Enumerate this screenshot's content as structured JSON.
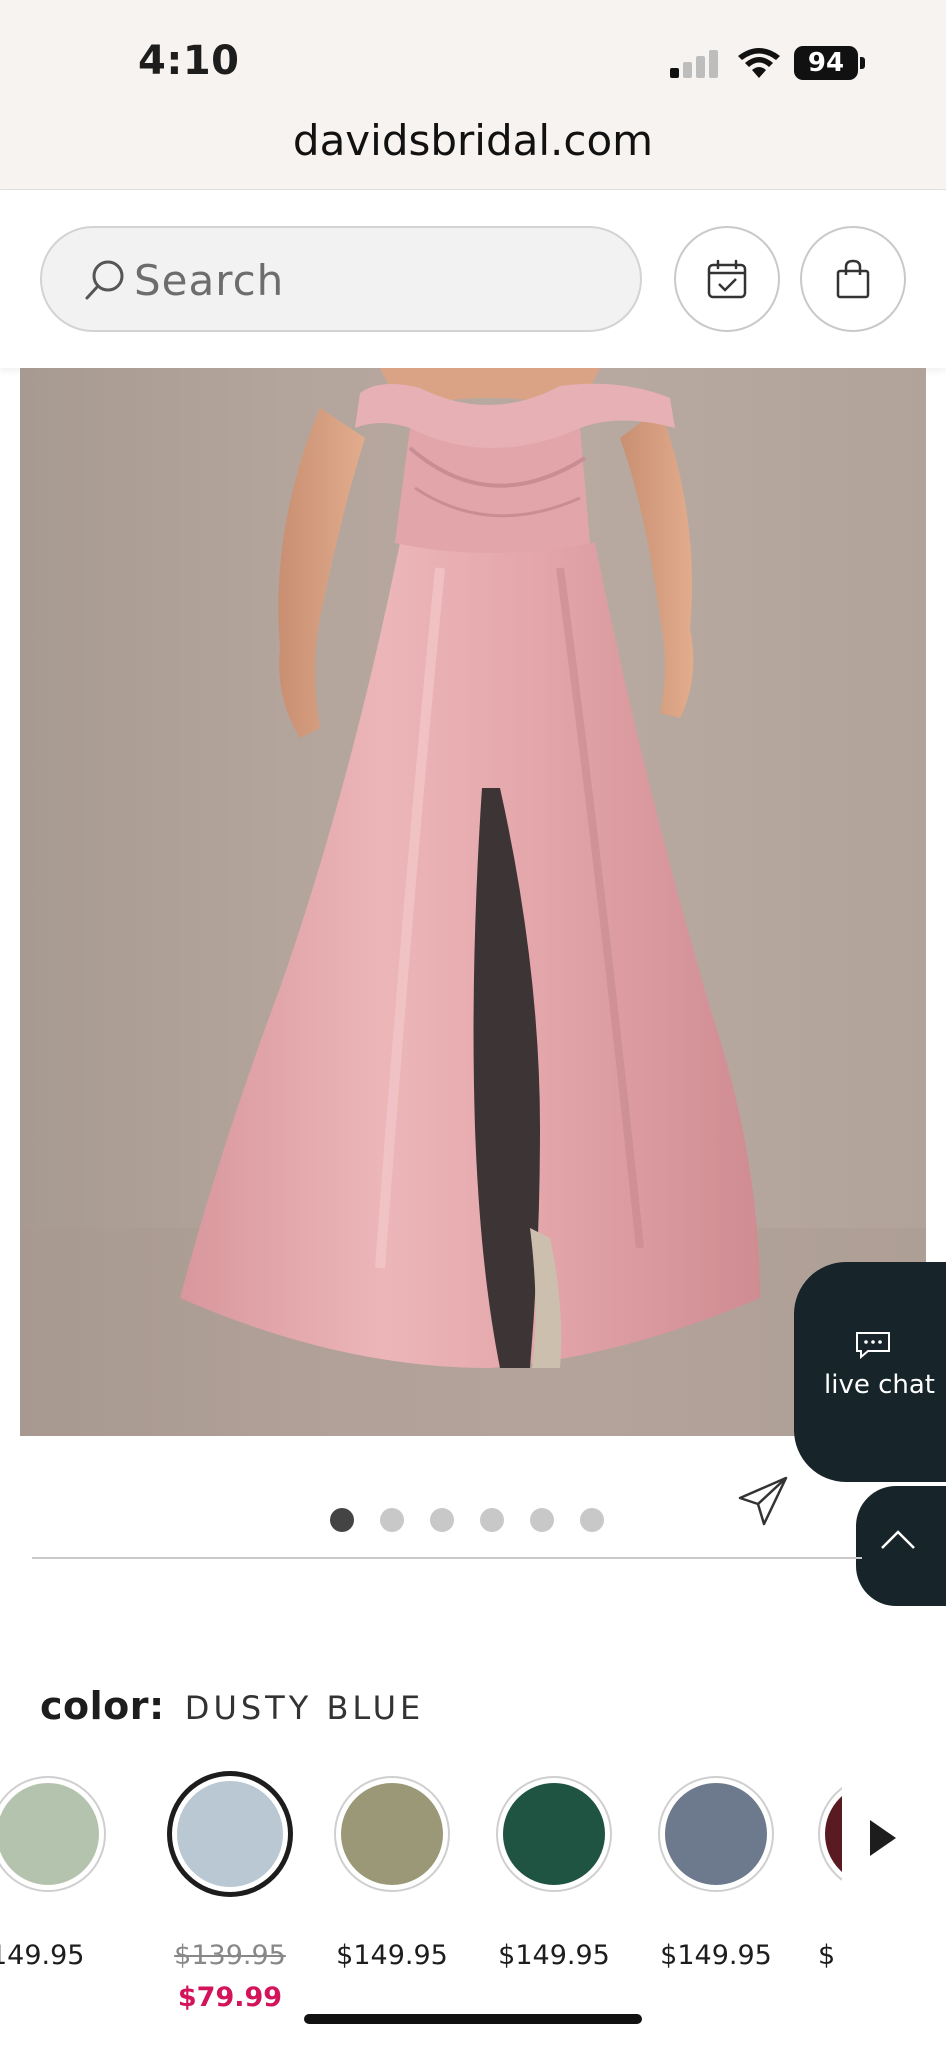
{
  "status_bar": {
    "time": "4:10",
    "battery": "94"
  },
  "browser": {
    "url": "davidsbridal.com"
  },
  "header": {
    "search_placeholder": "Search"
  },
  "product_image": {
    "alt": "Off-the-shoulder satin gown with slit",
    "carousel_total": 6,
    "carousel_active": 1
  },
  "live_chat": {
    "label": "live chat"
  },
  "color_selector": {
    "label": "color:",
    "selected_name": "DUSTY BLUE",
    "swatches": [
      {
        "color": "#b4c3ae",
        "price": "149.95"
      },
      {
        "color": "#b9c8d3",
        "price_was": "$139.95",
        "price_sale": "$79.99",
        "selected": true
      },
      {
        "color": "#9b9878",
        "price": "$149.95"
      },
      {
        "color": "#1f5442",
        "price": "$149.95"
      },
      {
        "color": "#6d7a8e",
        "price": "$149.95"
      },
      {
        "color": "#5a1a22",
        "price": "$"
      }
    ]
  },
  "colors": {
    "accent_sale": "#d3135a",
    "chat_bg": "#17252a",
    "dress": "#e4aaae"
  }
}
